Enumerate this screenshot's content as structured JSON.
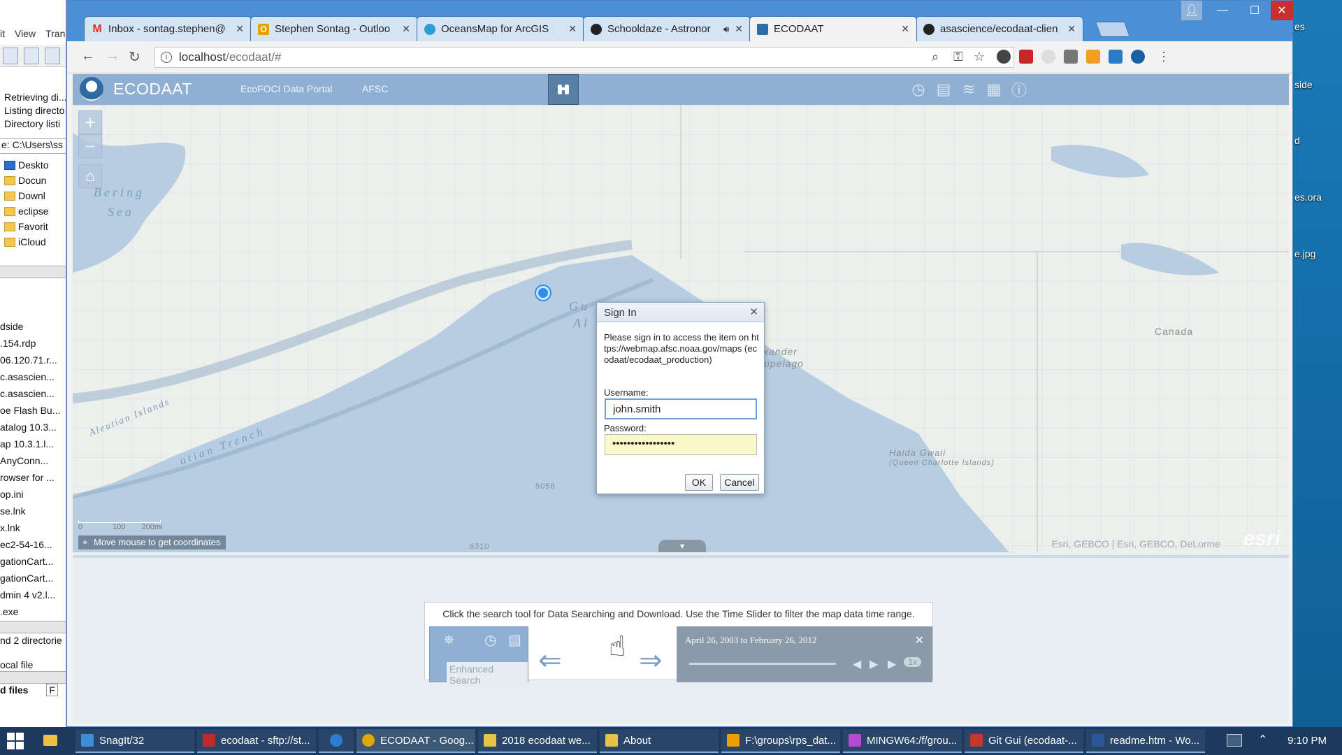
{
  "desktop": {
    "icons": [
      "side",
      "d",
      "es.ora",
      "e.jpg",
      "es"
    ]
  },
  "bg_window": {
    "menu": [
      "it",
      "View",
      "Tran"
    ],
    "log_lines": [
      "Retrieving di...",
      "Listing directo",
      "Directory listi"
    ],
    "path_label": "e:",
    "path_value": "C:\\Users\\ss",
    "tree": [
      "Deskto",
      "Docun",
      "Downl",
      "eclipse",
      "Favorit",
      "iCloud"
    ],
    "files": [
      "dside",
      ".154.rdp",
      "06.120.71.r...",
      "c.asascien...",
      "c.asascien...",
      "oe Flash Bu...",
      "atalog 10.3...",
      "ap 10.3.1.l...",
      "AnyConn...",
      "rowser for ...",
      "op.ini",
      "se.lnk",
      "x.lnk",
      "ec2-54-16...",
      "gationCart...",
      "gationCart...",
      "dmin 4 v2.l...",
      ".exe"
    ],
    "footer1": "nd 2 directorie",
    "footer2": "ocal file",
    "footer3": "d files",
    "footer3b": "F"
  },
  "browser": {
    "tabs": [
      {
        "title": "Inbox - sontag.stephen@",
        "icon": "gmail-icon",
        "color": "#d93025"
      },
      {
        "title": "Stephen Sontag - Outloo",
        "icon": "outlook-icon",
        "color": "#e8a100"
      },
      {
        "title": "OceansMap for ArcGIS",
        "icon": "oceansmap-icon",
        "color": "#2a9fd6"
      },
      {
        "title": "Schooldaze - Astronor",
        "icon": "spotify-icon",
        "color": "#222222"
      },
      {
        "title": "ECODAAT",
        "icon": "ecodaat-icon",
        "color": "#2b6ea6"
      },
      {
        "title": "asascience/ecodaat-clien",
        "icon": "github-icon",
        "color": "#222222"
      }
    ],
    "url": "localhost/ecodaat/#",
    "url_host": "localhost",
    "url_path": "/ecodaat/#"
  },
  "app": {
    "title": "ECODAAT",
    "nav": [
      "EcoFOCI Data Portal",
      "AFSC"
    ],
    "map": {
      "labels": {
        "bering": "Bering",
        "sea": "Sea",
        "gulf1": "Gu",
        "gulf2": "Al",
        "aleutian_islands": "Aleutian Islands",
        "trench": "utian Trench",
        "alexander1": "xander",
        "alexander2": "hipelago",
        "haida1": "Haida Gwaii",
        "haida2": "(Queen Charlotte Islands)",
        "canada": "Canada",
        "depth1": "5058",
        "depth2": "6310"
      },
      "scale": [
        "0",
        "100",
        "200mi"
      ],
      "coords_hint": "Move mouse to get coordinates",
      "attribution": "Esri, GEBCO | Esri, GEBCO, DeLorme",
      "esri": "esri"
    },
    "help": {
      "text": "Click the search tool for Data Searching and Download. Use the Time Slider to filter the map data time range.",
      "enhanced_search": "Enhanced Search",
      "time_range": "April 26, 2003 to February 26, 2012",
      "speed": "1x"
    }
  },
  "dialog": {
    "title": "Sign In",
    "message": "Please sign in to access the item on https://webmap.afsc.noaa.gov/maps (ecodaat/ecodaat_production)",
    "username_label": "Username:",
    "username_value": "john.smith",
    "password_label": "Password:",
    "password_mask": "•••••••••••••••••",
    "ok": "OK",
    "cancel": "Cancel"
  },
  "taskbar": {
    "items": [
      {
        "label": "SnagIt/32",
        "color": "#3a8fd8"
      },
      {
        "label": "ecodaat - sftp://st...",
        "color": "#bf2b2b"
      },
      {
        "label": "",
        "color": "#2c7cd1"
      },
      {
        "label": "ECODAAT - Goog...",
        "color": "#e0a800"
      },
      {
        "label": "2018 ecodaat we...",
        "color": "#e8c34a"
      },
      {
        "label": "About",
        "color": "#e8c34a"
      },
      {
        "label": "F:\\groups\\rps_dat...",
        "color": "#e8a100"
      },
      {
        "label": "MINGW64:/f/grou...",
        "color": "#b54ad6"
      },
      {
        "label": "Git Gui (ecodaat-...",
        "color": "#c0392b"
      },
      {
        "label": "readme.htm - Wo...",
        "color": "#2b5797"
      }
    ],
    "time": "9:10 PM"
  }
}
